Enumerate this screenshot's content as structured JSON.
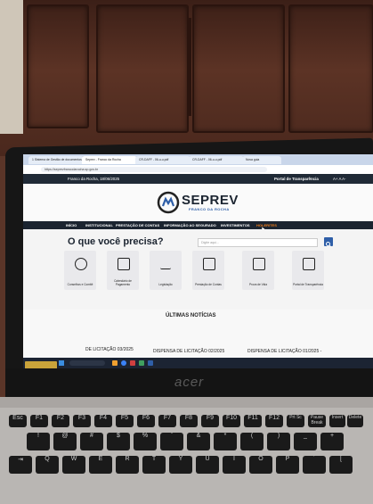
{
  "browser": {
    "tabs": [
      "1 Sistema de Gestão de documentos",
      "Seprev - Franco da Rocha",
      "CR-DAFF - 06-u-u.pdf",
      "CR-DAFF - 06-u-u.pdf",
      "Nova guia"
    ],
    "url": "https://seprevfrancodarocha.sp.gov.br"
  },
  "site": {
    "location_date": "Franco da Rocha, 18/06/2025",
    "portal_link": "Portal de Transparência",
    "font_controls": "A+  A  A-",
    "logo_name": "SEPREV",
    "logo_sub": "FRANCO DA ROCHA",
    "nav": [
      "INÍCIO",
      "INSTITUCIONAL",
      "PRESTAÇÃO DE CONTAS",
      "INFORMAÇÃO AO SEGURADO",
      "INVESTIMENTOS",
      "HOLERITES"
    ],
    "heading": "O que você precisa?",
    "search_placeholder": "Digite aqui...",
    "cards": [
      "Conselhos e Comitê",
      "Calendário de Pagamento",
      "Legislação",
      "Prestação de Contas",
      "Prova de Vida",
      "Portal de Transparência"
    ],
    "news_heading": "ÚLTIMAS NOTÍCIAS",
    "news": [
      "DE LICITAÇÃO 03/2025",
      "DISPENSA DE LICITAÇÃO 02/2025",
      "DISPENSA DE LICITAÇÃO 01/2025 -"
    ]
  },
  "device": {
    "brand": "acer"
  },
  "keyboard": {
    "fn_keys": [
      "F1",
      "F2",
      "F3",
      "F4",
      "F5",
      "F6",
      "F7",
      "F8",
      "F9",
      "F10",
      "F11",
      "F12",
      "Prt Sc",
      "Pause Break",
      "Insert",
      "Delete"
    ],
    "number_keys": [
      "!",
      "@",
      "#",
      "$",
      "%",
      "¨",
      "&",
      "*",
      "(",
      ")",
      "_",
      "+"
    ],
    "letter_keys": [
      "Q",
      "W",
      "E",
      "R",
      "T",
      "Y",
      "U",
      "I",
      "O",
      "P",
      "´",
      "["
    ]
  },
  "colors": {
    "nav_active": "#f07d1a",
    "site_dark": "#1b2430",
    "accent_blue": "#2f5fa8"
  }
}
